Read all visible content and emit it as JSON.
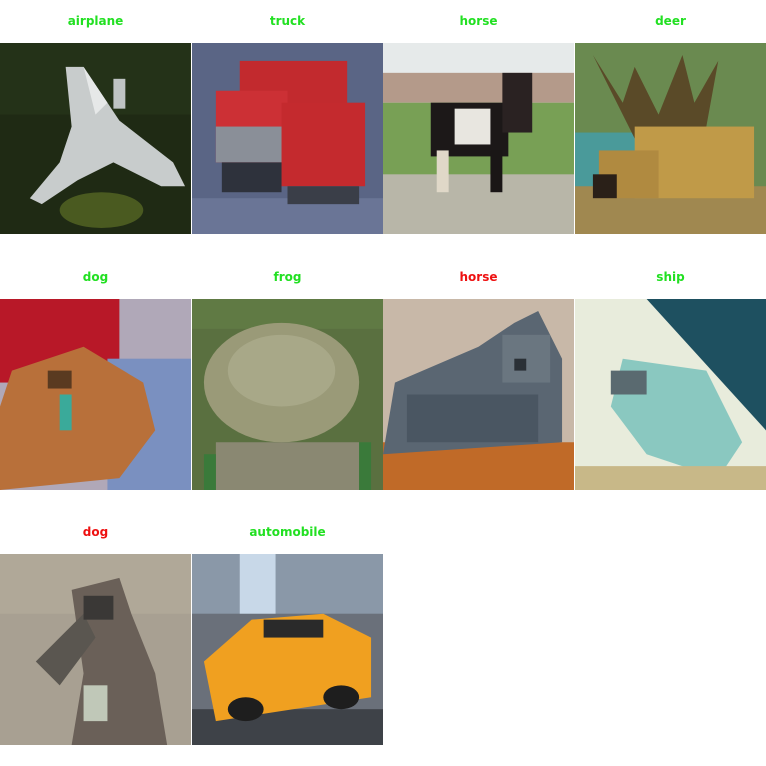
{
  "correct_color": "#22e022",
  "wrong_color": "#ee1111",
  "grid": [
    {
      "label": "airplane",
      "correct": true,
      "icon": "airplane-photo"
    },
    {
      "label": "truck",
      "correct": true,
      "icon": "truck-photo"
    },
    {
      "label": "horse",
      "correct": true,
      "icon": "horse-photo"
    },
    {
      "label": "deer",
      "correct": true,
      "icon": "deer-photo"
    },
    {
      "label": "dog",
      "correct": true,
      "icon": "dog-photo"
    },
    {
      "label": "frog",
      "correct": true,
      "icon": "frog-photo"
    },
    {
      "label": "horse",
      "correct": false,
      "icon": "cat-photo"
    },
    {
      "label": "ship",
      "correct": true,
      "icon": "ship-photo"
    },
    {
      "label": "dog",
      "correct": false,
      "icon": "bird-photo"
    },
    {
      "label": "automobile",
      "correct": true,
      "icon": "car-photo"
    }
  ]
}
